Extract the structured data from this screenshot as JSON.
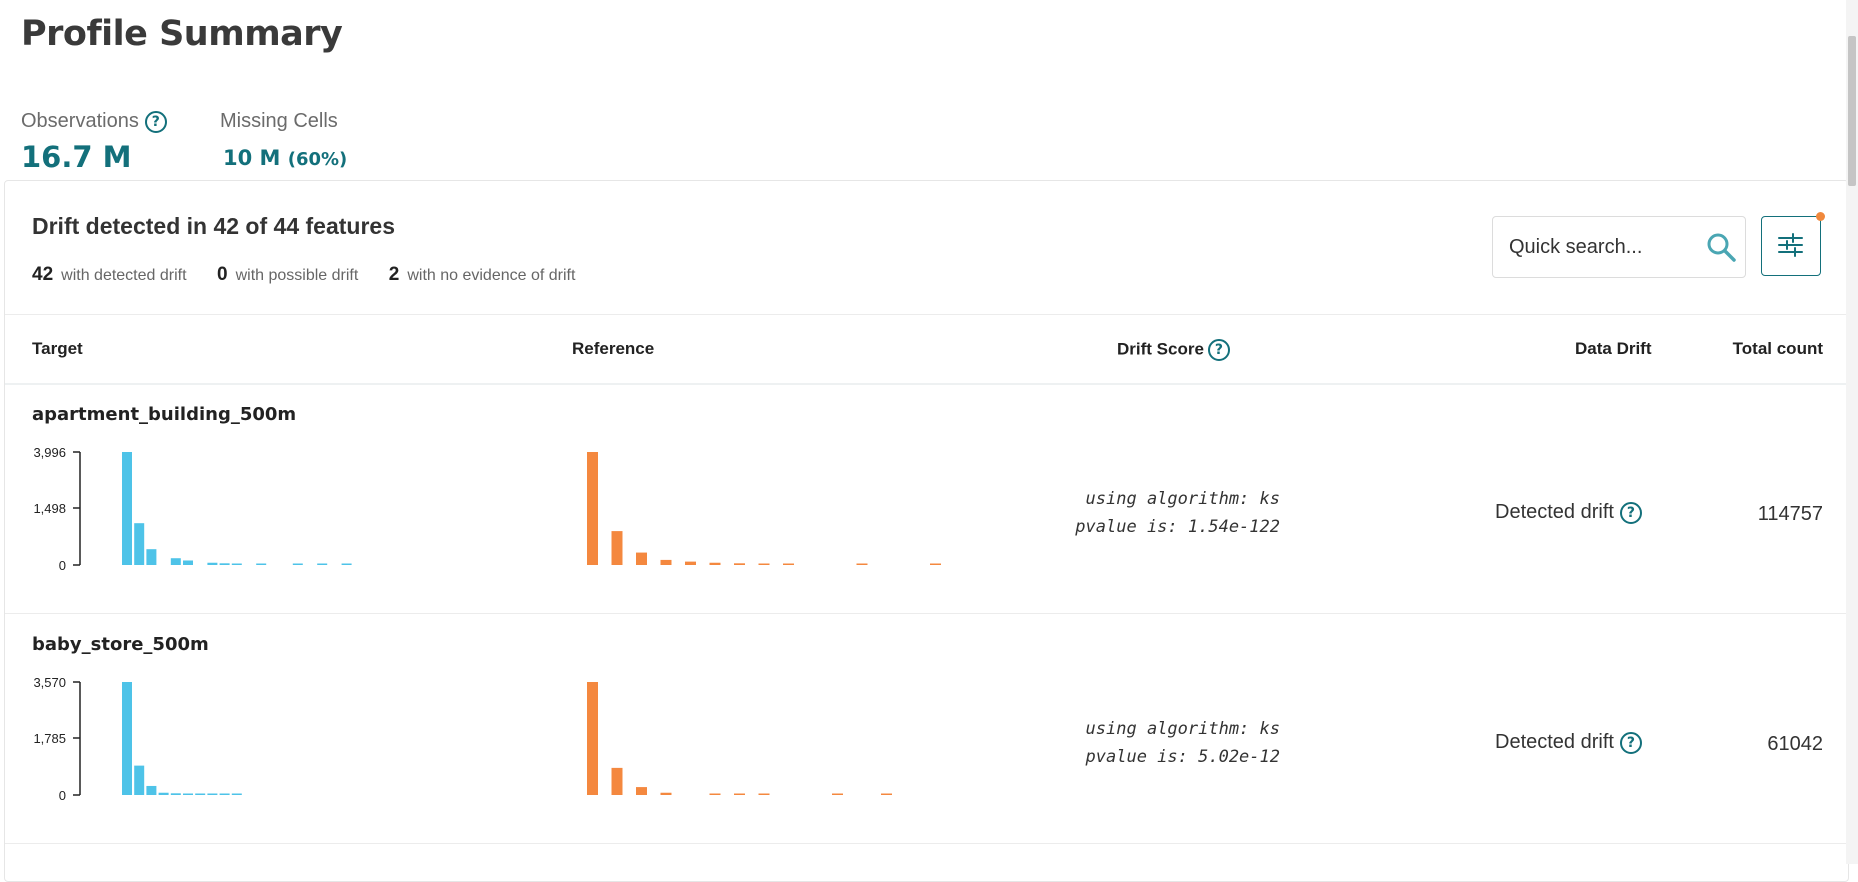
{
  "page": {
    "title": "Profile Summary"
  },
  "stats": {
    "observations": {
      "label": "Observations",
      "value": "16.7 M"
    },
    "missing_cells": {
      "label": "Missing Cells",
      "value": "10 M",
      "percent": "(60%)"
    }
  },
  "drift_summary": {
    "title": "Drift detected in 42 of 44 features",
    "counts": [
      {
        "num": "42",
        "label": "with detected drift"
      },
      {
        "num": "0",
        "label": "with possible drift"
      },
      {
        "num": "2",
        "label": "with no evidence of drift"
      }
    ]
  },
  "search": {
    "placeholder": "Quick search..."
  },
  "columns": {
    "target": "Target",
    "reference": "Reference",
    "drift_score": "Drift Score",
    "data_drift": "Data Drift",
    "total_count": "Total count"
  },
  "rows": [
    {
      "feature": "apartment_building_500m",
      "y_ticks": [
        "3,996",
        "1,498",
        "0"
      ],
      "target_values": [
        1.0,
        0.37,
        0.14,
        0,
        0.06,
        0.04,
        0,
        0.02,
        0.015,
        0.01,
        0,
        0.007,
        0,
        0,
        0.005,
        0,
        0.004,
        0,
        0.003
      ],
      "reference_values": [
        1.0,
        0.3,
        0.11,
        0.045,
        0.03,
        0.02,
        0.015,
        0.01,
        0.008,
        0,
        0,
        0.006,
        0,
        0,
        0.004
      ],
      "algorithm": "using algorithm: ks",
      "pvalue": "pvalue is: 1.54e-122",
      "status": "Detected drift",
      "total": "114757"
    },
    {
      "feature": "baby_store_500m",
      "y_ticks": [
        "3,570",
        "1,785",
        "0"
      ],
      "target_values": [
        1.0,
        0.26,
        0.08,
        0.02,
        0.015,
        0.01,
        0.008,
        0.005,
        0.003,
        0.002
      ],
      "reference_values": [
        1.0,
        0.24,
        0.07,
        0.02,
        0,
        0.012,
        0.008,
        0.006,
        0,
        0,
        0.003,
        0,
        0.002
      ],
      "algorithm": "using algorithm: ks",
      "pvalue": "pvalue is: 5.02e-12",
      "status": "Detected drift",
      "total": "61042"
    }
  ],
  "colors": {
    "accent": "#13707b",
    "target_bar": "#4ec3e8",
    "reference_bar": "#f4883f",
    "badge_dot": "#f0883c"
  }
}
